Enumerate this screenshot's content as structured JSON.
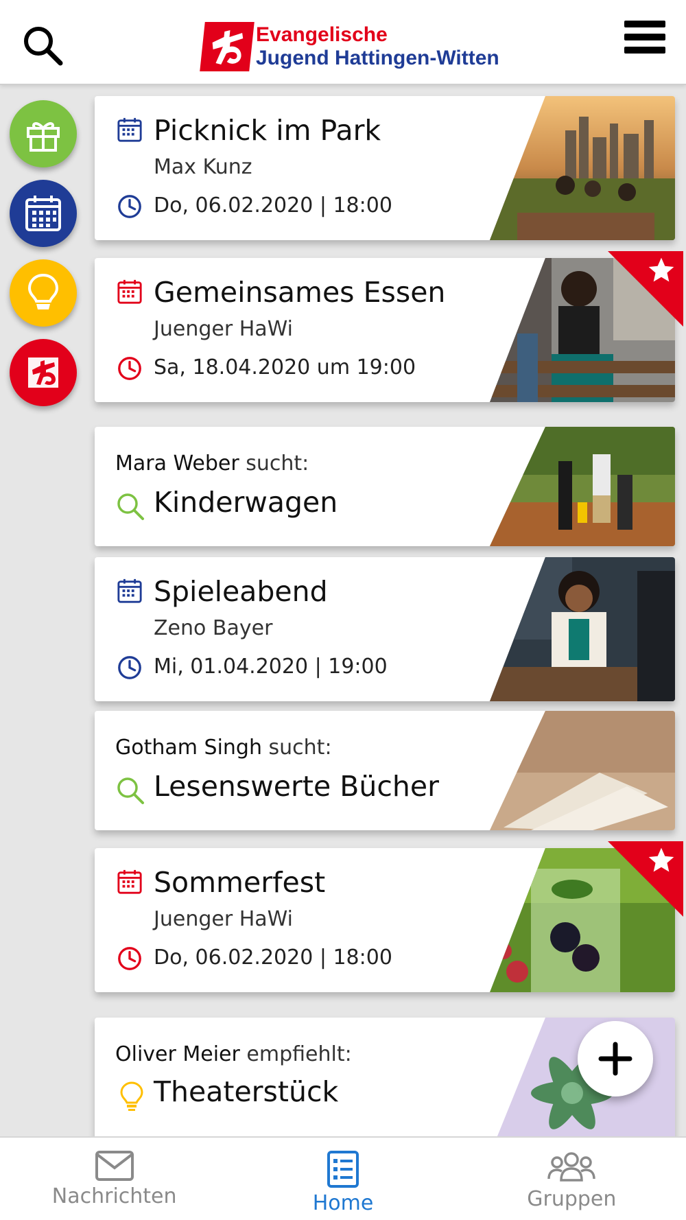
{
  "header": {
    "logo_line1": "Evangelische",
    "logo_line2": "Jugend Hattingen-Witten",
    "search_icon": "search-icon",
    "menu_icon": "hamburger-menu-icon"
  },
  "side_actions": [
    {
      "icon": "gift-icon",
      "color": "#7dc242"
    },
    {
      "icon": "calendar-icon",
      "color": "#1f3c96"
    },
    {
      "icon": "lightbulb-icon",
      "color": "#ffbf00"
    },
    {
      "icon": "logo-icon",
      "color": "#e2001a"
    }
  ],
  "feed": [
    {
      "type": "event",
      "title": "Picknick im Park",
      "organizer": "Max Kunz",
      "datetime": "Do, 06.02.2020 | 18:00",
      "accent": "#1f3c96",
      "favorite": false
    },
    {
      "type": "event",
      "title": "Gemeinsames Essen",
      "organizer": "Juenger HaWi",
      "datetime": "Sa, 18.04.2020 um 19:00",
      "accent": "#e2001a",
      "favorite": true
    },
    {
      "type": "request",
      "person": "Mara Weber",
      "verb": "sucht:",
      "title": "Kinderwagen",
      "accent": "#7dc242"
    },
    {
      "type": "event",
      "title": "Spieleabend",
      "organizer": "Zeno Bayer",
      "datetime": "Mi, 01.04.2020 | 19:00",
      "accent": "#1f3c96",
      "favorite": false
    },
    {
      "type": "request",
      "person": "Gotham Singh",
      "verb": "sucht:",
      "title": "Lesenswerte Bücher",
      "accent": "#7dc242"
    },
    {
      "type": "event",
      "title": "Sommerfest",
      "organizer": "Juenger HaWi",
      "datetime": "Do, 06.02.2020 | 18:00",
      "accent": "#e2001a",
      "favorite": true
    },
    {
      "type": "recommendation",
      "person": "Oliver Meier",
      "verb": "empfiehlt:",
      "title": "Theaterstück",
      "accent": "#ffbf00"
    }
  ],
  "fab": {
    "icon": "plus-icon"
  },
  "bottom_nav": [
    {
      "label": "Nachrichten",
      "icon": "mail-icon",
      "active": false
    },
    {
      "label": "Home",
      "icon": "list-icon",
      "active": true
    },
    {
      "label": "Gruppen",
      "icon": "group-icon",
      "active": false
    }
  ],
  "colors": {
    "active": "#1f78d1",
    "inactive": "#8a8a8a",
    "brand_red": "#e2001a",
    "brand_blue": "#1f3c96"
  }
}
